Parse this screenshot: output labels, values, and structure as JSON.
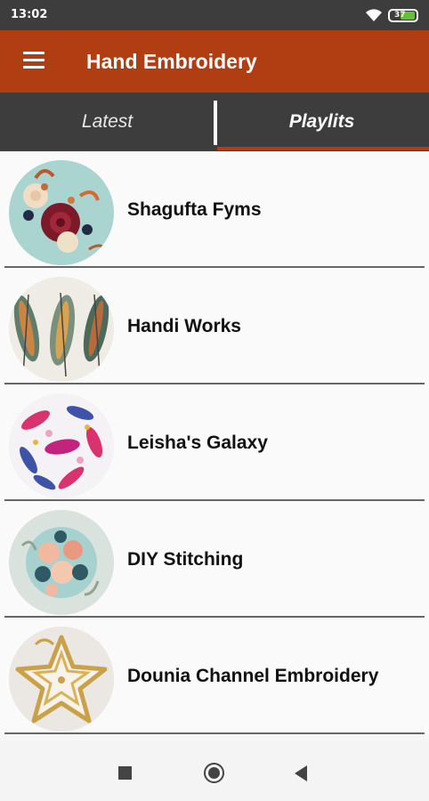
{
  "status_bar": {
    "time": "13:02",
    "battery": "37"
  },
  "app_bar": {
    "title": "Hand Embroidery",
    "menu_icon": "hamburger-menu-icon"
  },
  "tabs": [
    {
      "label": "Latest",
      "selected": false
    },
    {
      "label": "Playlits",
      "selected": true
    }
  ],
  "playlists": [
    {
      "label": "Shagufta Fyms",
      "thumbnail": "flowers-embroidery-image"
    },
    {
      "label": "Handi Works",
      "thumbnail": "feathers-embroidery-image"
    },
    {
      "label": "Leisha's Galaxy",
      "thumbnail": "leaves-hoop-embroidery-image"
    },
    {
      "label": "DIY Stitching",
      "thumbnail": "roses-hoop-embroidery-image"
    },
    {
      "label": "Dounia Channel Embroidery",
      "thumbnail": "beaded-star-embroidery-image"
    }
  ],
  "colors": {
    "accent": "#b13d13",
    "status_bar": "#3d3d3d",
    "tab_bar": "#3d3d3d"
  },
  "nav_bar": {
    "icons": [
      "recents-square-icon",
      "home-circle-icon",
      "back-triangle-icon"
    ]
  }
}
